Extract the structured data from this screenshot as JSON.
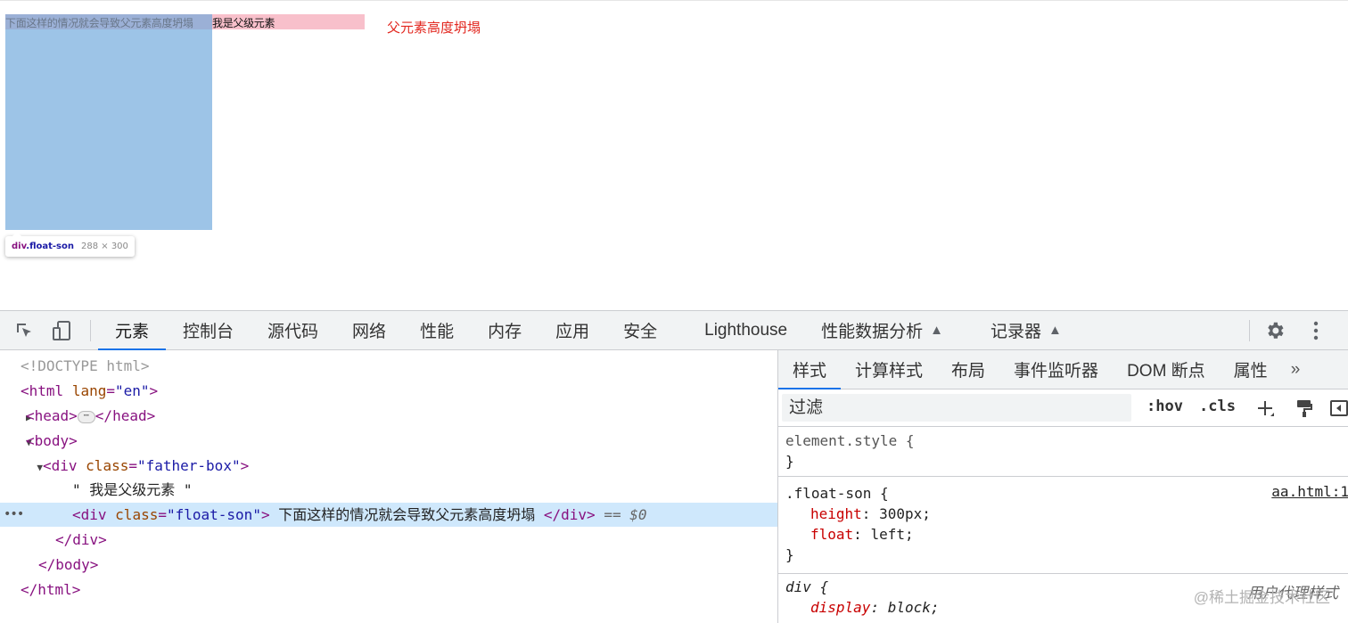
{
  "page": {
    "float_son_text": "下面这样的情况就会导致父元素高度坍塌",
    "father_text": "我是父级元素",
    "red_note": "父元素高度坍塌",
    "tooltip": {
      "tag": "div",
      "cls": ".float-son",
      "size": "288 × 300"
    },
    "colors": {
      "father_bg": "#f8c0cb",
      "float_bg": "#6fa8dc",
      "red_note": "#e2271f"
    }
  },
  "devtools": {
    "toolbar": {
      "inspect_icon": "inspect-cursor-icon",
      "device_icon": "device-toolbar-icon",
      "tabs": [
        {
          "label": "元素",
          "active": true
        },
        {
          "label": "控制台"
        },
        {
          "label": "源代码"
        },
        {
          "label": "网络"
        },
        {
          "label": "性能"
        },
        {
          "label": "内存"
        },
        {
          "label": "应用"
        },
        {
          "label": "安全"
        },
        {
          "label": "Lighthouse"
        },
        {
          "label": "性能数据分析",
          "flask": true
        },
        {
          "label": "记录器",
          "flask": true
        }
      ],
      "settings_icon": "gear-icon",
      "more_icon": "kebab-menu-icon"
    },
    "elements": {
      "doctype": "<!DOCTYPE html>",
      "html_open_tag": "<html",
      "html_lang_attr": "lang",
      "html_lang_val": "\"en\"",
      "gt": ">",
      "head_open": "<head>",
      "head_close": "</head>",
      "ellipsis": "⋯",
      "body_open": "<body>",
      "div_open": "<div",
      "class_attr": "class",
      "father_class": "\"father-box\"",
      "text_node": "\" 我是父级元素 \"",
      "float_class": "\"float-son\"",
      "float_inner_text": " 下面这样的情况就会导致父元素高度坍塌 ",
      "div_close": "</div>",
      "selected_marker": "== $0",
      "body_close": "</body>",
      "html_close": "</html>",
      "row_dots": "•••"
    },
    "styles": {
      "tabs": [
        {
          "label": "样式",
          "active": true
        },
        {
          "label": "计算样式"
        },
        {
          "label": "布局"
        },
        {
          "label": "事件监听器"
        },
        {
          "label": "DOM 断点"
        },
        {
          "label": "属性"
        },
        {
          "label": "»"
        }
      ],
      "filter_placeholder": "过滤",
      "hov": ":hov",
      "cls": ".cls",
      "add_icon": "plus-icon",
      "paint_icon": "paint-roller-icon",
      "sidebar_icon": "toggle-sidebar-icon",
      "element_style_selector": "element.style {",
      "close_brace": "}",
      "float_selector": ".float-son {",
      "float_source": "aa.html:1",
      "prop_height_name": "height",
      "prop_height_value": "300px",
      "prop_float_name": "float",
      "prop_float_value": "left",
      "div_selector": "div {",
      "ua_label": "用户代理样式",
      "prop_display_name": "display",
      "prop_display_value": "block"
    },
    "watermark": "@稀土掘金技术社区"
  }
}
